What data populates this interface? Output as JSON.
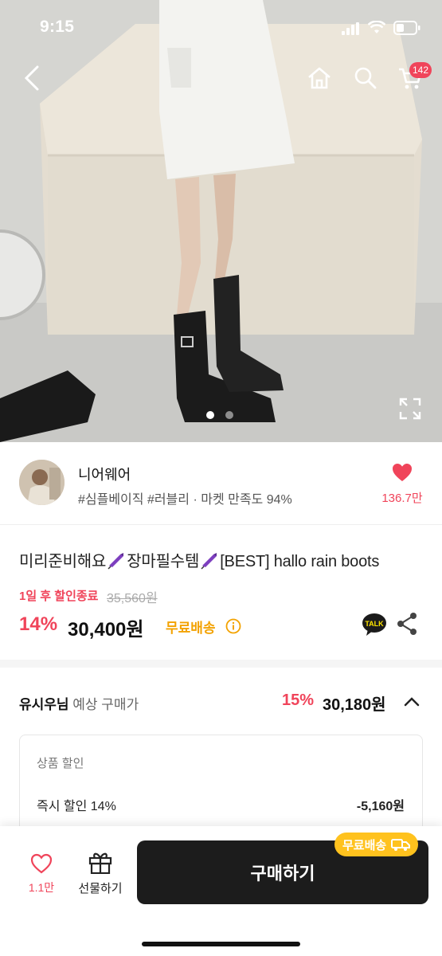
{
  "status_bar": {
    "time": "9:15"
  },
  "nav": {
    "cart_count": "142"
  },
  "gallery": {
    "page_count": 2,
    "active_index": 0
  },
  "seller": {
    "name": "니어웨어",
    "tags": "#심플베이직 #러블리 · 마켓 만족도 94%",
    "likes": "136.7만"
  },
  "product": {
    "title_part1": "미리준비해요",
    "title_part2": "장마필수템",
    "title_part3": "[BEST] hallo rain boots",
    "discount_end": "1일 후 할인종료",
    "original_price": "35,560원",
    "discount_rate": "14%",
    "price": "30,400원",
    "free_shipping": "무료배송",
    "talk_icon_text": "TALK"
  },
  "expected": {
    "user": "유시우님",
    "label": " 예상 구매가",
    "discount_rate": "15%",
    "price": "30,180원"
  },
  "discount_detail": {
    "header": "상품 할인",
    "rows": [
      {
        "label": "즉시 할인 14%",
        "value": "-5,160원"
      }
    ]
  },
  "bottom_bar": {
    "wish_count": "1.1만",
    "gift_label": "선물하기",
    "buy_label": "구매하기",
    "free_shipping_pill": "무료배송"
  },
  "colors": {
    "accent": "#f0445a",
    "free_ship": "#f3a200",
    "pill": "#ffc21e",
    "buy_bg": "#1c1c1c"
  }
}
